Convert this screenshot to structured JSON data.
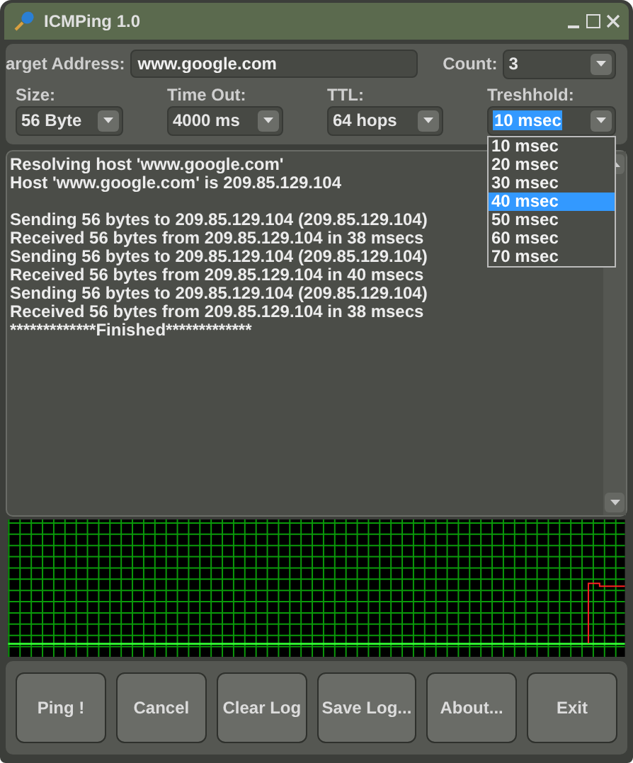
{
  "window": {
    "title": "ICMPing 1.0"
  },
  "target": {
    "label": "arget Address:",
    "value": "www.google.com"
  },
  "count": {
    "label": "Count:",
    "value": "3"
  },
  "options": [
    {
      "label": "Size:",
      "value": "56 Byte",
      "open": false
    },
    {
      "label": "Time Out:",
      "value": "4000 ms",
      "open": false
    },
    {
      "label": "TTL:",
      "value": "64 hops",
      "open": false
    },
    {
      "label": "Treshhold:",
      "value": "10 msec",
      "open": true
    }
  ],
  "threshold_list": [
    {
      "label": "10 msec",
      "selected": false
    },
    {
      "label": "20 msec",
      "selected": false
    },
    {
      "label": "30 msec",
      "selected": false
    },
    {
      "label": "40 msec",
      "selected": true
    },
    {
      "label": "50 msec",
      "selected": false
    },
    {
      "label": "60 msec",
      "selected": false
    },
    {
      "label": "70 msec",
      "selected": false
    }
  ],
  "log_paragraphs": [
    [
      "Resolving host 'www.google.com'",
      "Host 'www.google.com' is 209.85.129.104"
    ],
    [
      "Sending 56 bytes to 209.85.129.104 (209.85.129.104)",
      "Received 56 bytes from 209.85.129.104 in 38 msecs",
      "Sending 56 bytes to 209.85.129.104 (209.85.129.104)",
      "Received 56 bytes from 209.85.129.104 in 40 msecs",
      "Sending 56 bytes to 209.85.129.104 (209.85.129.104)",
      "Received 56 bytes from 209.85.129.104 in 38 msecs",
      "*************Finished*************"
    ]
  ],
  "buttons": [
    "Ping !",
    "Cancel",
    "Clear Log",
    "Save Log...",
    "About...",
    "Exit"
  ]
}
